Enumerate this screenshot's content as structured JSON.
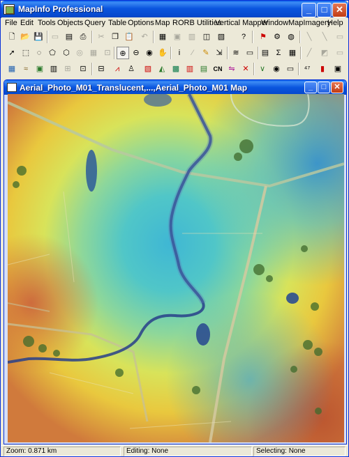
{
  "app": {
    "title": "MapInfo Professional"
  },
  "menu": [
    "File",
    "Edit",
    "Tools",
    "Objects",
    "Query",
    "Table",
    "Options",
    "Map",
    "RORB Utilities",
    "Vertical Mapper",
    "Window",
    "MapImagery",
    "Help"
  ],
  "toolbars": {
    "row1": [
      "new",
      "open",
      "save",
      "save",
      "print",
      "cut",
      "copy",
      "paste",
      "undo",
      "browser",
      "map",
      "graph",
      "layout",
      "help-pointer",
      "run",
      "tool",
      "globe"
    ],
    "row2": [
      "select",
      "marquee",
      "radius",
      "polygon",
      "boundary",
      "invert",
      "select-all",
      "zoom-in",
      "zoom-out",
      "zoom-change",
      "pan",
      "info",
      "label",
      "drag",
      "layer",
      "legend",
      "statistics",
      "sum",
      "calc",
      "line",
      "polyline",
      "rect"
    ],
    "row3": [
      "grid",
      "contour",
      "profile",
      "vertical",
      "region",
      "mapwin",
      "cross",
      "person",
      "redlog",
      "dots",
      "ruler",
      "barbar",
      "bars",
      "cn",
      "arrow",
      "xmark",
      "cross2",
      "valley",
      "eye",
      "shapes",
      "lines",
      "hex",
      "numbers",
      "colorbar",
      "square"
    ]
  },
  "map_window": {
    "title": "Aerial_Photo_M01_Translucent,...,Aerial_Photo_M01 Map"
  },
  "status": {
    "zoom": "Zoom: 0.871 km",
    "editing": "Editing: None",
    "selecting": "Selecting: None"
  },
  "colors": {
    "titlebar": "#0a55de",
    "chrome": "#ece9d8",
    "close_button": "#c13b12"
  }
}
